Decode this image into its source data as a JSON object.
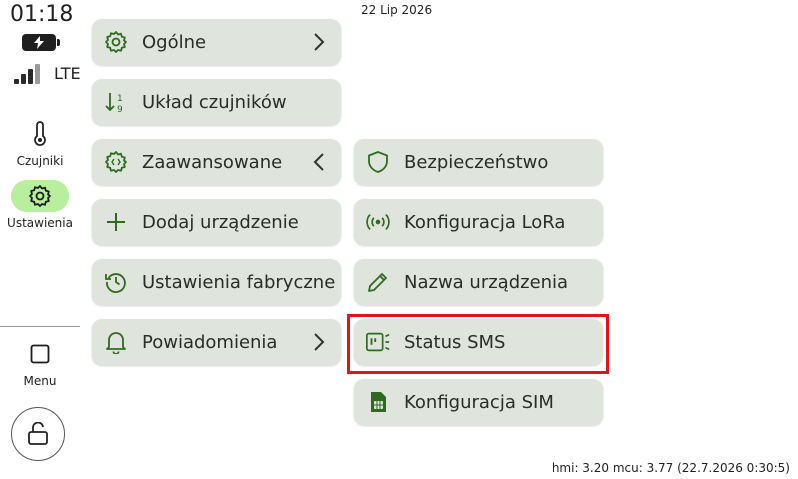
{
  "status": {
    "time": "01:18",
    "network": "LTE",
    "date": "22 Lip 2026"
  },
  "sidebar": {
    "items": [
      {
        "label": "Czujniki",
        "icon": "thermometer-icon"
      },
      {
        "label": "Ustawienia",
        "icon": "gear-icon",
        "active": true
      }
    ],
    "menu_label": "Menu",
    "lock_icon": "unlock-icon"
  },
  "settings": {
    "column1": [
      {
        "label": "Ogólne",
        "icon": "gear-icon",
        "chevron": "right"
      },
      {
        "label": "Układ czujników",
        "icon": "sort-icon"
      },
      {
        "label": "Zaawansowane",
        "icon": "gear-code-icon",
        "chevron": "left"
      },
      {
        "label": "Dodaj urządzenie",
        "icon": "plus-icon"
      },
      {
        "label": "Ustawienia fabryczne",
        "icon": "history-icon"
      },
      {
        "label": "Powiadomienia",
        "icon": "bell-icon",
        "chevron": "right"
      }
    ],
    "column2": [
      {
        "label": "Bezpieczeństwo",
        "icon": "shield-icon"
      },
      {
        "label": "Konfiguracja LoRa",
        "icon": "radio-icon"
      },
      {
        "label": "Nazwa urządzenia",
        "icon": "pencil-icon"
      },
      {
        "label": "Status SMS",
        "icon": "sms-status-icon"
      },
      {
        "label": "Konfiguracja SIM",
        "icon": "sim-card-icon"
      }
    ]
  },
  "footer": {
    "version": "hmi: 3.20 mcu: 3.77 (22.7.2026 0:30:5)"
  },
  "colors": {
    "icon_green": "#2e6b1e",
    "button_bg": "#dfe4dc",
    "active_pill": "#b8ef9e",
    "highlight": "#e0141a"
  }
}
